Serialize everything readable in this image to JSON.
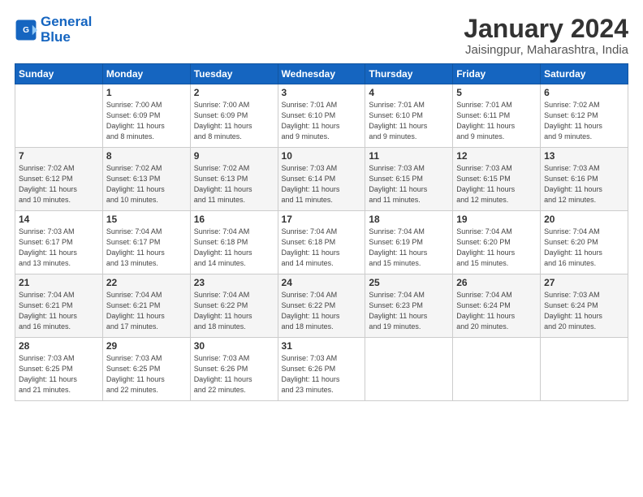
{
  "header": {
    "logo_line1": "General",
    "logo_line2": "Blue",
    "month_year": "January 2024",
    "location": "Jaisingpur, Maharashtra, India"
  },
  "columns": [
    "Sunday",
    "Monday",
    "Tuesday",
    "Wednesday",
    "Thursday",
    "Friday",
    "Saturday"
  ],
  "weeks": [
    [
      {
        "day": "",
        "info": ""
      },
      {
        "day": "1",
        "info": "Sunrise: 7:00 AM\nSunset: 6:09 PM\nDaylight: 11 hours\nand 8 minutes."
      },
      {
        "day": "2",
        "info": "Sunrise: 7:00 AM\nSunset: 6:09 PM\nDaylight: 11 hours\nand 8 minutes."
      },
      {
        "day": "3",
        "info": "Sunrise: 7:01 AM\nSunset: 6:10 PM\nDaylight: 11 hours\nand 9 minutes."
      },
      {
        "day": "4",
        "info": "Sunrise: 7:01 AM\nSunset: 6:10 PM\nDaylight: 11 hours\nand 9 minutes."
      },
      {
        "day": "5",
        "info": "Sunrise: 7:01 AM\nSunset: 6:11 PM\nDaylight: 11 hours\nand 9 minutes."
      },
      {
        "day": "6",
        "info": "Sunrise: 7:02 AM\nSunset: 6:12 PM\nDaylight: 11 hours\nand 9 minutes."
      }
    ],
    [
      {
        "day": "7",
        "info": "Sunrise: 7:02 AM\nSunset: 6:12 PM\nDaylight: 11 hours\nand 10 minutes."
      },
      {
        "day": "8",
        "info": "Sunrise: 7:02 AM\nSunset: 6:13 PM\nDaylight: 11 hours\nand 10 minutes."
      },
      {
        "day": "9",
        "info": "Sunrise: 7:02 AM\nSunset: 6:13 PM\nDaylight: 11 hours\nand 11 minutes."
      },
      {
        "day": "10",
        "info": "Sunrise: 7:03 AM\nSunset: 6:14 PM\nDaylight: 11 hours\nand 11 minutes."
      },
      {
        "day": "11",
        "info": "Sunrise: 7:03 AM\nSunset: 6:15 PM\nDaylight: 11 hours\nand 11 minutes."
      },
      {
        "day": "12",
        "info": "Sunrise: 7:03 AM\nSunset: 6:15 PM\nDaylight: 11 hours\nand 12 minutes."
      },
      {
        "day": "13",
        "info": "Sunrise: 7:03 AM\nSunset: 6:16 PM\nDaylight: 11 hours\nand 12 minutes."
      }
    ],
    [
      {
        "day": "14",
        "info": "Sunrise: 7:03 AM\nSunset: 6:17 PM\nDaylight: 11 hours\nand 13 minutes."
      },
      {
        "day": "15",
        "info": "Sunrise: 7:04 AM\nSunset: 6:17 PM\nDaylight: 11 hours\nand 13 minutes."
      },
      {
        "day": "16",
        "info": "Sunrise: 7:04 AM\nSunset: 6:18 PM\nDaylight: 11 hours\nand 14 minutes."
      },
      {
        "day": "17",
        "info": "Sunrise: 7:04 AM\nSunset: 6:18 PM\nDaylight: 11 hours\nand 14 minutes."
      },
      {
        "day": "18",
        "info": "Sunrise: 7:04 AM\nSunset: 6:19 PM\nDaylight: 11 hours\nand 15 minutes."
      },
      {
        "day": "19",
        "info": "Sunrise: 7:04 AM\nSunset: 6:20 PM\nDaylight: 11 hours\nand 15 minutes."
      },
      {
        "day": "20",
        "info": "Sunrise: 7:04 AM\nSunset: 6:20 PM\nDaylight: 11 hours\nand 16 minutes."
      }
    ],
    [
      {
        "day": "21",
        "info": "Sunrise: 7:04 AM\nSunset: 6:21 PM\nDaylight: 11 hours\nand 16 minutes."
      },
      {
        "day": "22",
        "info": "Sunrise: 7:04 AM\nSunset: 6:21 PM\nDaylight: 11 hours\nand 17 minutes."
      },
      {
        "day": "23",
        "info": "Sunrise: 7:04 AM\nSunset: 6:22 PM\nDaylight: 11 hours\nand 18 minutes."
      },
      {
        "day": "24",
        "info": "Sunrise: 7:04 AM\nSunset: 6:22 PM\nDaylight: 11 hours\nand 18 minutes."
      },
      {
        "day": "25",
        "info": "Sunrise: 7:04 AM\nSunset: 6:23 PM\nDaylight: 11 hours\nand 19 minutes."
      },
      {
        "day": "26",
        "info": "Sunrise: 7:04 AM\nSunset: 6:24 PM\nDaylight: 11 hours\nand 20 minutes."
      },
      {
        "day": "27",
        "info": "Sunrise: 7:03 AM\nSunset: 6:24 PM\nDaylight: 11 hours\nand 20 minutes."
      }
    ],
    [
      {
        "day": "28",
        "info": "Sunrise: 7:03 AM\nSunset: 6:25 PM\nDaylight: 11 hours\nand 21 minutes."
      },
      {
        "day": "29",
        "info": "Sunrise: 7:03 AM\nSunset: 6:25 PM\nDaylight: 11 hours\nand 22 minutes."
      },
      {
        "day": "30",
        "info": "Sunrise: 7:03 AM\nSunset: 6:26 PM\nDaylight: 11 hours\nand 22 minutes."
      },
      {
        "day": "31",
        "info": "Sunrise: 7:03 AM\nSunset: 6:26 PM\nDaylight: 11 hours\nand 23 minutes."
      },
      {
        "day": "",
        "info": ""
      },
      {
        "day": "",
        "info": ""
      },
      {
        "day": "",
        "info": ""
      }
    ]
  ]
}
